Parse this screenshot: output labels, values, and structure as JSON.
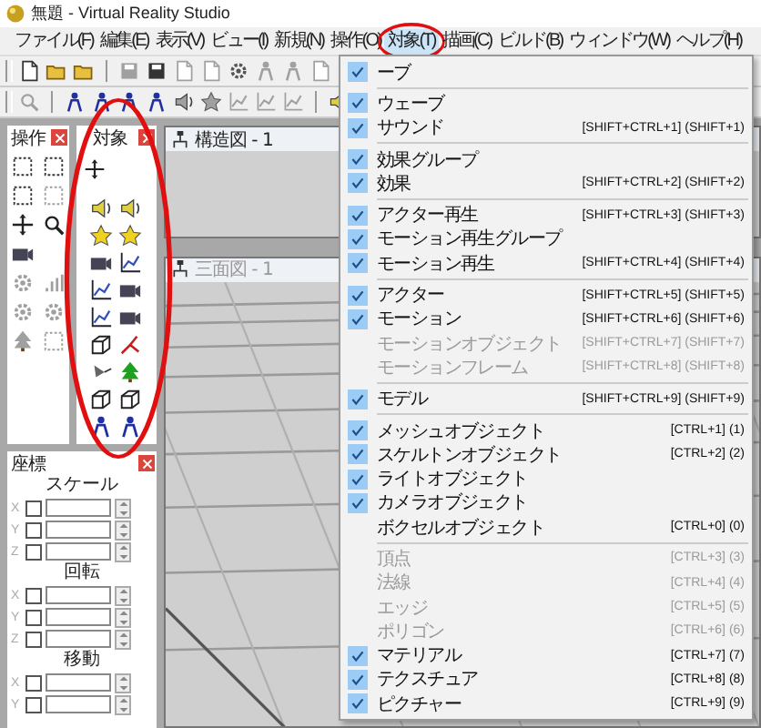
{
  "window": {
    "title": "無題 - Virtual Reality Studio"
  },
  "menubar": [
    {
      "label": "ファイル(F)",
      "selected": false
    },
    {
      "label": "編集(E)",
      "selected": false
    },
    {
      "label": "表示(V)",
      "selected": false
    },
    {
      "label": "ビュー(I)",
      "selected": false
    },
    {
      "label": "新規(N)",
      "selected": false
    },
    {
      "label": "操作(O)",
      "selected": false
    },
    {
      "label": "対象(T)",
      "selected": true
    },
    {
      "label": "描画(C)",
      "selected": false
    },
    {
      "label": "ビルド(B)",
      "selected": false
    },
    {
      "label": "ウィンドウ(W)",
      "selected": false
    },
    {
      "label": "ヘルプ(H)",
      "selected": false
    }
  ],
  "dropdown": {
    "groups": [
      [
        {
          "label": "ーブ",
          "checked": true,
          "disabled": false
        }
      ],
      [
        {
          "label": "ウェーブ",
          "checked": true,
          "disabled": false
        },
        {
          "label": "サウンド",
          "shortcut": "[SHIFT+CTRL+1] (SHIFT+1)",
          "checked": true,
          "disabled": false
        }
      ],
      [
        {
          "label": "効果グループ",
          "checked": true,
          "disabled": false
        },
        {
          "label": "効果",
          "shortcut": "[SHIFT+CTRL+2] (SHIFT+2)",
          "checked": true,
          "disabled": false
        }
      ],
      [
        {
          "label": "アクター再生",
          "shortcut": "[SHIFT+CTRL+3] (SHIFT+3)",
          "checked": true,
          "disabled": false
        },
        {
          "label": "モーション再生グループ",
          "checked": true,
          "disabled": false
        },
        {
          "label": "モーション再生",
          "shortcut": "[SHIFT+CTRL+4] (SHIFT+4)",
          "checked": true,
          "disabled": false
        }
      ],
      [
        {
          "label": "アクター",
          "shortcut": "[SHIFT+CTRL+5] (SHIFT+5)",
          "checked": true,
          "disabled": false
        },
        {
          "label": "モーション",
          "shortcut": "[SHIFT+CTRL+6] (SHIFT+6)",
          "checked": true,
          "disabled": false
        },
        {
          "label": "モーションオブジェクト",
          "shortcut": "[SHIFT+CTRL+7] (SHIFT+7)",
          "checked": false,
          "disabled": true
        },
        {
          "label": "モーションフレーム",
          "shortcut": "[SHIFT+CTRL+8] (SHIFT+8)",
          "checked": false,
          "disabled": true
        }
      ],
      [
        {
          "label": "モデル",
          "shortcut": "[SHIFT+CTRL+9] (SHIFT+9)",
          "checked": true,
          "disabled": false
        }
      ],
      [
        {
          "label": "メッシュオブジェクト",
          "shortcut": "[CTRL+1] (1)",
          "checked": true,
          "disabled": false
        },
        {
          "label": "スケルトンオブジェクト",
          "shortcut": "[CTRL+2] (2)",
          "checked": true,
          "disabled": false
        },
        {
          "label": "ライトオブジェクト",
          "checked": true,
          "disabled": false
        },
        {
          "label": "カメラオブジェクト",
          "checked": true,
          "disabled": false
        },
        {
          "label": "ボクセルオブジェクト",
          "shortcut": "[CTRL+0] (0)",
          "checked": false,
          "disabled": false
        }
      ],
      [
        {
          "label": "頂点",
          "shortcut": "[CTRL+3] (3)",
          "checked": false,
          "disabled": true
        },
        {
          "label": "法線",
          "shortcut": "[CTRL+4] (4)",
          "checked": false,
          "disabled": true
        },
        {
          "label": "エッジ",
          "shortcut": "[CTRL+5] (5)",
          "checked": false,
          "disabled": true
        },
        {
          "label": "ポリゴン",
          "shortcut": "[CTRL+6] (6)",
          "checked": false,
          "disabled": true
        },
        {
          "label": "マテリアル",
          "shortcut": "[CTRL+7] (7)",
          "checked": true,
          "disabled": false
        },
        {
          "label": "テクスチュア",
          "shortcut": "[CTRL+8] (8)",
          "checked": true,
          "disabled": false
        },
        {
          "label": "ピクチャー",
          "shortcut": "[CTRL+9] (9)",
          "checked": true,
          "disabled": false
        }
      ]
    ]
  },
  "panels": {
    "operation": {
      "title": "操作"
    },
    "target": {
      "title": "対象"
    },
    "coords": {
      "title": "座標",
      "sections": [
        {
          "heading": "スケール",
          "axes": [
            {
              "label": "X",
              "checked": false
            },
            {
              "label": "Y",
              "checked": false
            },
            {
              "label": "Z",
              "checked": false
            }
          ]
        },
        {
          "heading": "回転",
          "axes": [
            {
              "label": "X",
              "checked": false
            },
            {
              "label": "Y",
              "checked": false
            },
            {
              "label": "Z",
              "checked": false
            }
          ]
        },
        {
          "heading": "移動",
          "axes": [
            {
              "label": "X",
              "checked": false
            },
            {
              "label": "Y",
              "checked": false
            }
          ]
        }
      ]
    }
  },
  "viewports": [
    {
      "title": "構造図 - 1",
      "active": true,
      "kind": "empty"
    },
    {
      "title": "三面図 - 1",
      "active": false,
      "kind": "grid"
    }
  ]
}
